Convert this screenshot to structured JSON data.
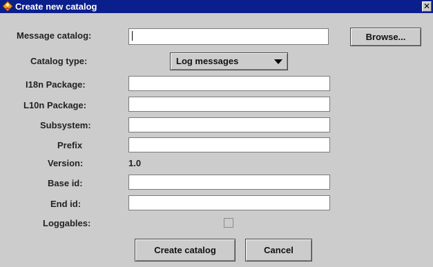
{
  "window": {
    "title": "Create new catalog",
    "close_glyph": "✕"
  },
  "icons": {
    "window_icon": "app-logo-icon",
    "close_icon": "close-icon",
    "dropdown_icon": "chevron-down-icon"
  },
  "form": {
    "message_catalog": {
      "label": "Message catalog:",
      "value": ""
    },
    "browse_button": "Browse...",
    "catalog_type": {
      "label": "Catalog type:",
      "selected": "Log messages"
    },
    "i18n_package": {
      "label": "I18n Package:",
      "value": ""
    },
    "l10n_package": {
      "label": "L10n Package:",
      "value": ""
    },
    "subsystem": {
      "label": "Subsystem:",
      "value": ""
    },
    "prefix": {
      "label": "Prefix",
      "value": ""
    },
    "version": {
      "label": "Version:",
      "value": "1.0"
    },
    "base_id": {
      "label": "Base id:",
      "value": ""
    },
    "end_id": {
      "label": "End id:",
      "value": ""
    },
    "loggables": {
      "label": "Loggables:",
      "checked": false
    }
  },
  "actions": {
    "create": "Create catalog",
    "cancel": "Cancel"
  },
  "colors": {
    "titlebar": "#0a1e8c",
    "background": "#cccccc",
    "field": "#ffffff"
  }
}
